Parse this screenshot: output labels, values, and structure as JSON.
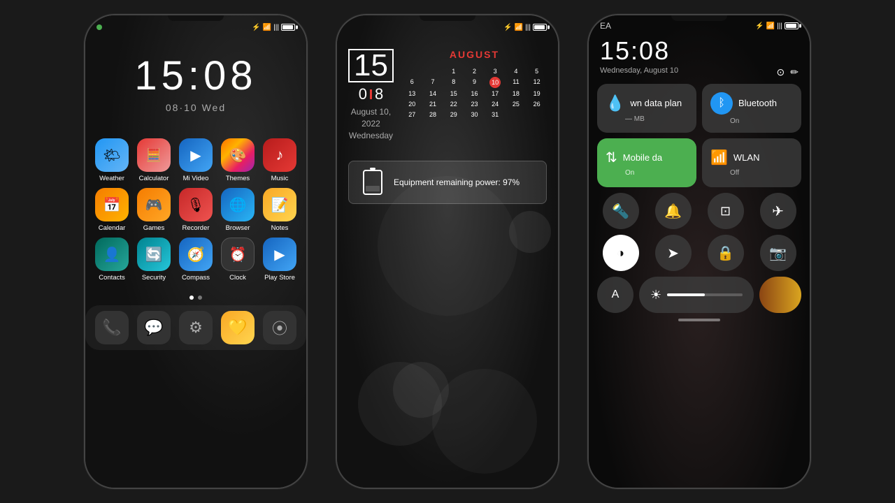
{
  "phone1": {
    "time": "15:08",
    "date": "08·10  Wed",
    "apps_row1": [
      {
        "label": "Weather",
        "icon_class": "icon-weather",
        "icon": "🌤"
      },
      {
        "label": "Calculator",
        "icon_class": "icon-calculator",
        "icon": "🧮"
      },
      {
        "label": "Mi Video",
        "icon_class": "icon-mivideo",
        "icon": "▶"
      },
      {
        "label": "Themes",
        "icon_class": "icon-themes",
        "icon": "🎨"
      },
      {
        "label": "Music",
        "icon_class": "icon-music",
        "icon": "♪"
      }
    ],
    "apps_row2": [
      {
        "label": "Calendar",
        "icon_class": "icon-calendar",
        "icon": "📅"
      },
      {
        "label": "Games",
        "icon_class": "icon-games",
        "icon": "🎮"
      },
      {
        "label": "Recorder",
        "icon_class": "icon-recorder",
        "icon": "🎙"
      },
      {
        "label": "Browser",
        "icon_class": "icon-browser",
        "icon": "🌐"
      },
      {
        "label": "Notes",
        "icon_class": "icon-notes",
        "icon": "📝"
      }
    ],
    "apps_row3": [
      {
        "label": "Contacts",
        "icon_class": "icon-contacts",
        "icon": "👤"
      },
      {
        "label": "Security",
        "icon_class": "icon-security",
        "icon": "🔄"
      },
      {
        "label": "Compass",
        "icon_class": "icon-compass",
        "icon": "🧭"
      },
      {
        "label": "Clock",
        "icon_class": "icon-clock",
        "icon": "⏰"
      },
      {
        "label": "Play Store",
        "icon_class": "icon-playstore",
        "icon": "▶"
      }
    ]
  },
  "phone2": {
    "day": "15",
    "time_h": "0",
    "time_m": "8",
    "month": "AUGUST",
    "date_info": "August 10,\n2022\nWednesday",
    "battery_text": "Equipment remaining power: 97%",
    "cal_headers": [
      "",
      "",
      "",
      "",
      "",
      "",
      ""
    ],
    "cal_days": [
      "",
      "",
      "1",
      "2",
      "3",
      "4",
      "5",
      "6",
      "7",
      "8",
      "9",
      "10",
      "11",
      "12",
      "13",
      "14",
      "15",
      "16",
      "17",
      "18",
      "19",
      "20",
      "21",
      "22",
      "23",
      "24",
      "25",
      "26",
      "27",
      "28",
      "29",
      "30",
      "31",
      "",
      ""
    ],
    "today": "10"
  },
  "phone3": {
    "ea_label": "EA",
    "time": "15:08",
    "date": "Wednesday, August 10",
    "data_plan_label": "wn data plan",
    "data_plan_sub": "— MB",
    "bluetooth_label": "Bluetooth",
    "bluetooth_sub": "On",
    "mobile_data_label": "Mobile da",
    "mobile_data_sub": "On",
    "wlan_label": "WLAN",
    "wlan_sub": "Off",
    "btn1": "🔦",
    "btn2": "🔔",
    "btn3": "✂",
    "btn4": "✈",
    "btn5": "◉",
    "btn6": "➤",
    "btn7": "🔒",
    "btn8": "📷",
    "letter_a": "A"
  }
}
